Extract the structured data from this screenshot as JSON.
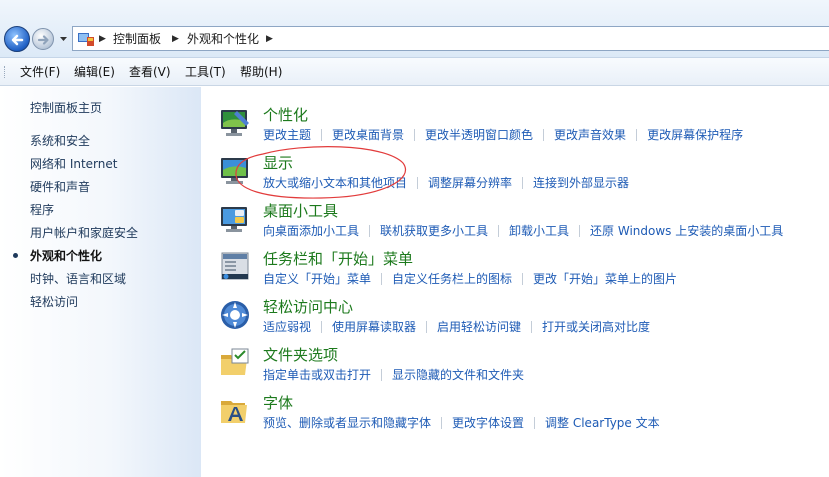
{
  "address": {
    "crumbs": [
      "控制面板",
      "外观和个性化"
    ]
  },
  "menu": [
    "文件(F)",
    "编辑(E)",
    "查看(V)",
    "工具(T)",
    "帮助(H)"
  ],
  "sidebar": {
    "home": "控制面板主页",
    "items": [
      "系统和安全",
      "网络和 Internet",
      "硬件和声音",
      "程序",
      "用户帐户和家庭安全",
      "外观和个性化",
      "时钟、语言和区域",
      "轻松访问"
    ],
    "selected_index": 5
  },
  "categories": [
    {
      "title": "个性化",
      "links": [
        "更改主题",
        "更改桌面背景",
        "更改半透明窗口颜色",
        "更改声音效果",
        "更改屏幕保护程序"
      ]
    },
    {
      "title": "显示",
      "links": [
        "放大或缩小文本和其他项目",
        "调整屏幕分辨率",
        "连接到外部显示器"
      ]
    },
    {
      "title": "桌面小工具",
      "links": [
        "向桌面添加小工具",
        "联机获取更多小工具",
        "卸载小工具",
        "还原 Windows 上安装的桌面小工具"
      ]
    },
    {
      "title": "任务栏和「开始」菜单",
      "links": [
        "自定义「开始」菜单",
        "自定义任务栏上的图标",
        "更改「开始」菜单上的图片"
      ]
    },
    {
      "title": "轻松访问中心",
      "links": [
        "适应弱视",
        "使用屏幕读取器",
        "启用轻松访问键",
        "打开或关闭高对比度"
      ]
    },
    {
      "title": "文件夹选项",
      "links": [
        "指定单击或双击打开",
        "显示隐藏的文件和文件夹"
      ]
    },
    {
      "title": "字体",
      "links": [
        "预览、删除或者显示和隐藏字体",
        "更改字体设置",
        "调整 ClearType 文本"
      ]
    }
  ],
  "colors": {
    "category_title": "#1d7a1d",
    "link": "#1e5bb5",
    "annotation_circle": "#e23c3c"
  }
}
